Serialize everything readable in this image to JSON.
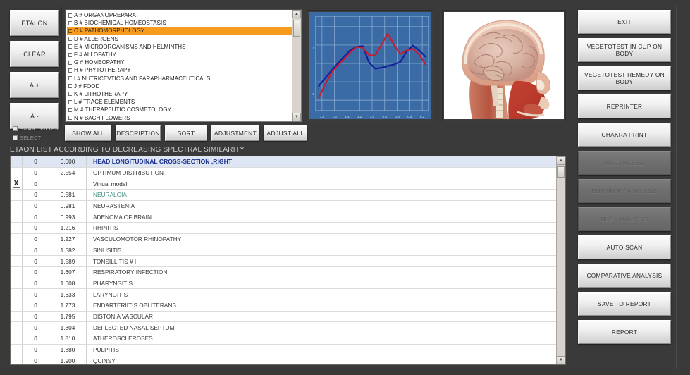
{
  "left_buttons": [
    {
      "label": "ETALON",
      "name": "etalon-button"
    },
    {
      "label": "CLEAR",
      "name": "clear-button"
    },
    {
      "label": "A +",
      "name": "a-plus-button"
    },
    {
      "label": "A -",
      "name": "a-minus-button"
    }
  ],
  "checkboxes": [
    {
      "label": "SMART FILTER",
      "checked": true,
      "name": "smart-filter-checkbox"
    },
    {
      "label": "SELECT",
      "checked": true,
      "name": "select-checkbox"
    }
  ],
  "category_list": {
    "selected_index": 2,
    "items": [
      "A # ORGANOPREPARAT",
      "B # BIOCHEMICAL HOMEOSTASIS",
      "C # PATHOMORPHOLOGY",
      "D # ALLERGENS",
      "E # MICROORGANISMS AND HELMINTHS",
      "F # ALLOPATHY",
      "G # HOMEOPATHY",
      "H # PHYTOTHERAPY",
      "I # NUTRICEVTICS AND PARAPHARMACEUTICALS",
      "J # FOOD",
      "K # LITHOTHERAPY",
      "L # TRACE ELEMENTS",
      "M # THERAPEUTIC COSMETOLOGY",
      "N # BACH FLOWERS"
    ]
  },
  "toolbar": [
    {
      "label": "SHOW ALL",
      "name": "show-all-button",
      "cls": "tb1"
    },
    {
      "label": "DESCRIPTION",
      "name": "description-button",
      "cls": "tb2"
    },
    {
      "label": "SORT",
      "name": "sort-button",
      "cls": "tb3"
    },
    {
      "label": "ADJUSTMENT",
      "name": "adjustment-button",
      "cls": "tb4"
    },
    {
      "label": "ADJUST ALL",
      "name": "adjust-all-button",
      "cls": "tb5"
    }
  ],
  "list_heading": "ETAON LIST ACCORDING TO DECREASING SPECTRAL SIMILARITY",
  "results": {
    "rows": [
      {
        "mark": "",
        "num": "0",
        "value": "0.000",
        "name": "HEAD LONGITUDINAL CROSS-SECTION ,RIGHT",
        "style": "first"
      },
      {
        "mark": "",
        "num": "0",
        "value": "2.554",
        "name": "OPTIMUM DISTRIBUTION",
        "style": "plain"
      },
      {
        "mark": "X",
        "num": "0",
        "value": "",
        "name": "Virtual model",
        "style": "virtual"
      },
      {
        "mark": "",
        "num": "0",
        "value": "0.581",
        "name": "NEURALGIA",
        "style": "teal"
      },
      {
        "mark": "",
        "num": "0",
        "value": "0.981",
        "name": "NEURASTENIA",
        "style": "plain"
      },
      {
        "mark": "",
        "num": "0",
        "value": "0.993",
        "name": "ADENOMA  OF BRAIN",
        "style": "plain"
      },
      {
        "mark": "",
        "num": "0",
        "value": "1.216",
        "name": "RHINITIS",
        "style": "plain"
      },
      {
        "mark": "",
        "num": "0",
        "value": "1.227",
        "name": "VASCULOMOTOR   RHINOPATHY",
        "style": "plain"
      },
      {
        "mark": "",
        "num": "0",
        "value": "1.582",
        "name": "SINUSITIS",
        "style": "plain"
      },
      {
        "mark": "",
        "num": "0",
        "value": "1.589",
        "name": "TONSILLITIS  # I",
        "style": "plain"
      },
      {
        "mark": "",
        "num": "0",
        "value": "1.607",
        "name": "RESPIRATORY  INFECTION",
        "style": "plain"
      },
      {
        "mark": "",
        "num": "0",
        "value": "1.608",
        "name": "PHARYNGITIS",
        "style": "plain"
      },
      {
        "mark": "",
        "num": "0",
        "value": "1.633",
        "name": "LARYNGITIS",
        "style": "plain"
      },
      {
        "mark": "",
        "num": "0",
        "value": "1.773",
        "name": "ENDARTERIITIS  OBLITERANS",
        "style": "plain"
      },
      {
        "mark": "",
        "num": "0",
        "value": "1.795",
        "name": "DISTONIA VASCULAR",
        "style": "plain"
      },
      {
        "mark": "",
        "num": "0",
        "value": "1.804",
        "name": "DEFLECTED NASAL SEPTUM",
        "style": "plain"
      },
      {
        "mark": "",
        "num": "0",
        "value": "1.810",
        "name": "ATHEROSCLEROSES",
        "style": "plain"
      },
      {
        "mark": "",
        "num": "0",
        "value": "1.880",
        "name": "PULPITIS",
        "style": "plain"
      },
      {
        "mark": "",
        "num": "0",
        "value": "1.900",
        "name": "QUINSY",
        "style": "plain"
      }
    ]
  },
  "right_buttons": [
    {
      "label": "EXIT",
      "name": "exit-button",
      "disabled": false
    },
    {
      "label": "VEGETOTEST IN CUP ON BODY",
      "name": "vegetotest-in-cup-on-body-button",
      "disabled": false
    },
    {
      "label": "VEGETOTEST REMEDY ON BODY",
      "name": "vegetotest-remedy-on-body-button",
      "disabled": false
    },
    {
      "label": "REPRINTER",
      "name": "reprinter-button",
      "disabled": false
    },
    {
      "label": "CHAKRA PRINT",
      "name": "chakra-print-button",
      "disabled": false
    },
    {
      "label": "AUTO MODEL",
      "name": "auto-model-button",
      "disabled": true
    },
    {
      "label": "ENTHROPY ANALYSIS",
      "name": "enthropy-analysis-button",
      "disabled": true
    },
    {
      "label": "NLS - ANALYSIS",
      "name": "nls-analysis-button",
      "disabled": true
    },
    {
      "label": "AUTO SCAN",
      "name": "auto-scan-button",
      "disabled": false
    },
    {
      "label": "COMPARATIVE ANALYSIS",
      "name": "comparative-analysis-button",
      "disabled": false
    },
    {
      "label": "SAVE TO REPORT",
      "name": "save-to-report-button",
      "disabled": false
    },
    {
      "label": "REPORT",
      "name": "report-button",
      "disabled": false
    }
  ],
  "colors": {
    "accent_orange": "#f59b1e",
    "chart_bg": "#3b6ba5",
    "chart_grid": "#9fc0e2",
    "series_blue": "#14219c",
    "series_red": "#c41e33",
    "window_bg": "#3a3a3a",
    "first_row_bg": "#dde6f2",
    "first_row_text": "#1c2f8f",
    "teal_text": "#3f8d82"
  },
  "chart_data": {
    "type": "line",
    "title": "",
    "xlabel": "",
    "ylabel": "",
    "xlim": [
      1.9,
      0.1
    ],
    "ylim": [
      -0.2,
      1.6
    ],
    "grid": true,
    "legend": "none",
    "xtick_labels": [
      "1.8",
      "1.6",
      "1.4",
      "1.2",
      "1.0",
      "0.8",
      "0.6",
      "0.4",
      "0.2"
    ],
    "ytick_labels": [
      "1",
      "0"
    ],
    "x": [
      1.85,
      1.75,
      1.65,
      1.55,
      1.45,
      1.35,
      1.25,
      1.15,
      1.05,
      0.95,
      0.85,
      0.75,
      0.65,
      0.55,
      0.45,
      0.35,
      0.25,
      0.15
    ],
    "series": [
      {
        "name": "etalon-spectrum",
        "color": "#14219c",
        "values": [
          0.27,
          0.42,
          0.56,
          0.7,
          0.83,
          0.95,
          1.02,
          1.03,
          0.72,
          0.6,
          0.62,
          0.65,
          0.68,
          0.73,
          0.93,
          1.04,
          0.95,
          0.83
        ]
      },
      {
        "name": "measured-spectrum",
        "color": "#c41e33",
        "values": [
          0.05,
          0.3,
          0.52,
          0.66,
          0.78,
          0.91,
          1.02,
          1.0,
          0.86,
          0.85,
          1.06,
          1.27,
          1.05,
          0.88,
          0.95,
          0.98,
          0.87,
          0.68
        ]
      }
    ]
  },
  "anatomy": {
    "caption": "head-sagittal-section",
    "alt": "anatomical sagittal cross-section of human head showing brain"
  },
  "scrollbars": {
    "up_arrow": "▲",
    "down_arrow": "▼"
  }
}
